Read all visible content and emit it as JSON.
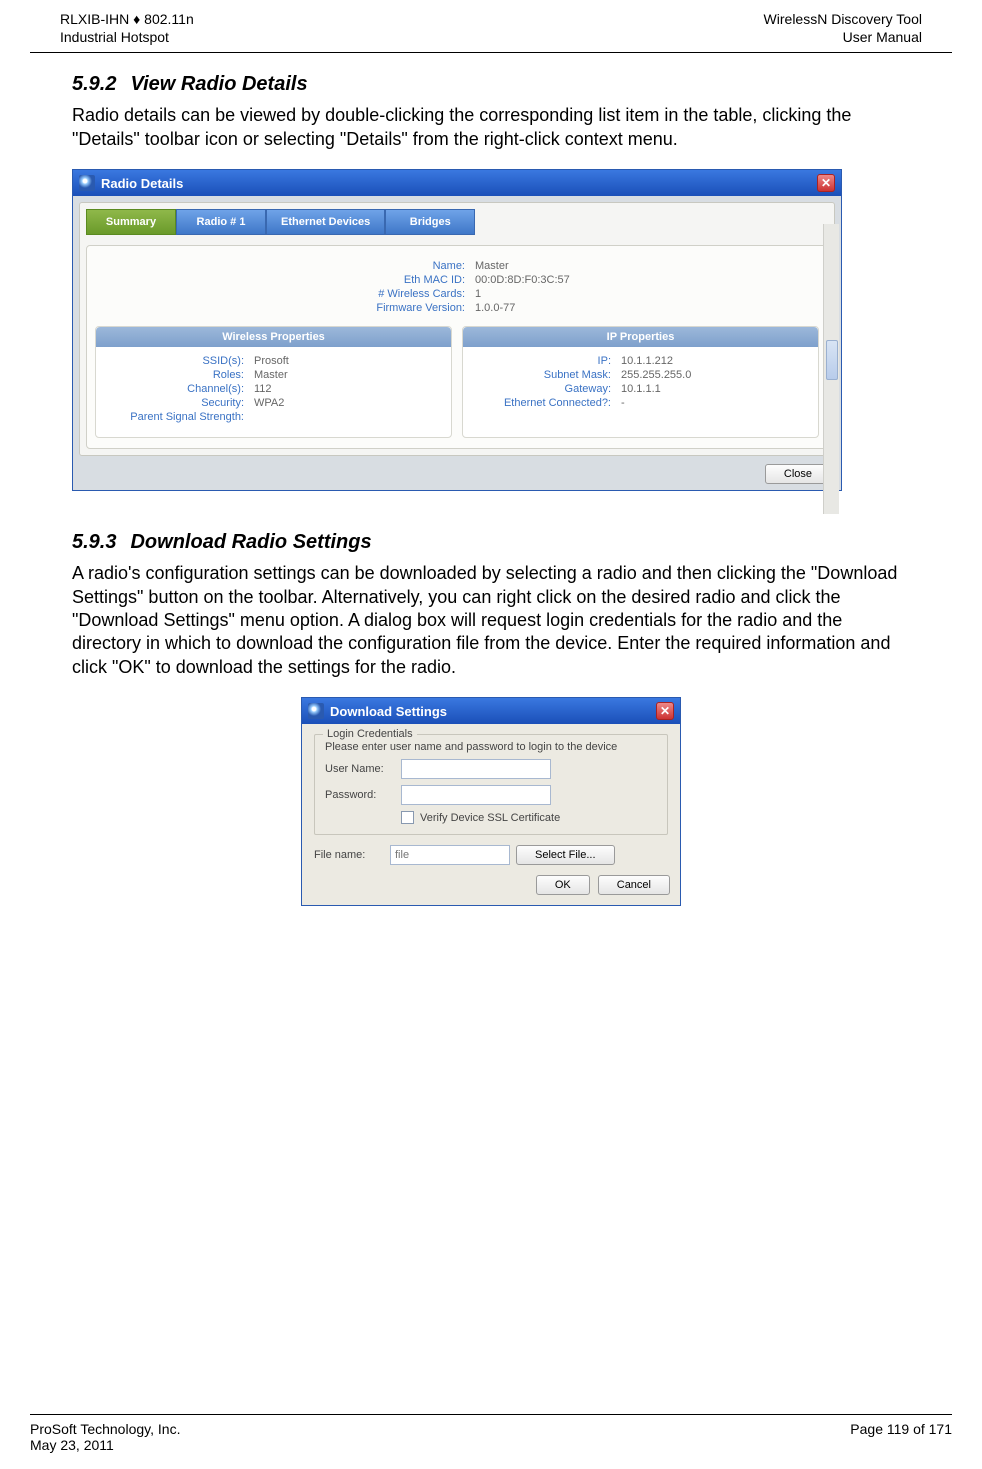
{
  "header": {
    "left1": "RLXIB-IHN ♦ 802.11n",
    "left2": "Industrial Hotspot",
    "right1": "WirelessN Discovery Tool",
    "right2": "User Manual"
  },
  "section592": {
    "num": "5.9.2",
    "title": "View Radio Details",
    "body": "Radio details can be viewed by double-clicking the corresponding list item in the table, clicking the \"Details\" toolbar icon or selecting \"Details\" from the right-click context menu."
  },
  "radioDetails": {
    "windowTitle": "Radio Details",
    "tabs": [
      "Summary",
      "Radio # 1",
      "Ethernet Devices",
      "Bridges"
    ],
    "activeTab": 0,
    "summary": {
      "Name": "Master",
      "Eth MAC ID": "00:0D:8D:F0:3C:57",
      "# Wireless Cards": "1",
      "Firmware Version": "1.0.0-77"
    },
    "wirelessTitle": "Wireless Properties",
    "wireless": {
      "SSID(s)": "Prosoft",
      "Roles": "Master",
      "Channel(s)": "112",
      "Security": "WPA2",
      "Parent Signal Strength": ""
    },
    "ipTitle": "IP Properties",
    "ip": {
      "IP": "10.1.1.212",
      "Subnet Mask": "255.255.255.0",
      "Gateway": "10.1.1.1",
      "Ethernet Connected?": "-"
    },
    "closeLabel": "Close"
  },
  "section593": {
    "num": "5.9.3",
    "title": "Download Radio Settings",
    "body": "A radio's configuration settings can be downloaded by selecting a radio and then clicking the \"Download Settings\" button on the toolbar. Alternatively, you can right click on the desired radio and click the \"Download Settings\" menu option. A dialog box will request login credentials for the radio and the directory in which to download the configuration file from the device. Enter the required information and click \"OK\" to download the settings for the radio."
  },
  "download": {
    "windowTitle": "Download Settings",
    "legend": "Login Credentials",
    "prompt": "Please enter user name and password to login to the device",
    "userLabel": "User Name:",
    "passLabel": "Password:",
    "checkboxLabel": "Verify Device SSL Certificate",
    "fileLabel": "File name:",
    "filePlaceholder": "file",
    "selectFile": "Select File...",
    "ok": "OK",
    "cancel": "Cancel"
  },
  "footer": {
    "left1": "ProSoft Technology, Inc.",
    "left2": "May 23, 2011",
    "right": "Page 119 of 171"
  }
}
